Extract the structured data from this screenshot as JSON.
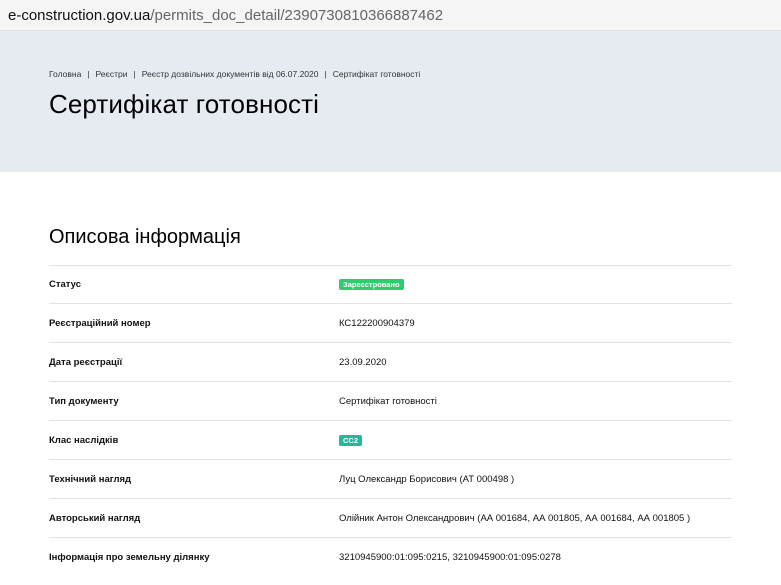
{
  "url": {
    "domain": "e-construction.gov.ua",
    "path": "/permits_doc_detail/2390730810366887462"
  },
  "breadcrumb": [
    "Головна",
    "Реєстри",
    "Реєстр дозвільних документів від 06.07.2020",
    "Сертифікат готовності"
  ],
  "page_title": "Сертифікат готовності",
  "section_title": "Описова інформація",
  "rows": [
    {
      "label": "Статус",
      "value": "Зареєстровано",
      "badge": "green"
    },
    {
      "label": "Реєстраційний номер",
      "value": "КС122200904379"
    },
    {
      "label": "Дата реєстрації",
      "value": "23.09.2020"
    },
    {
      "label": "Тип документу",
      "value": "Сертифікат готовності"
    },
    {
      "label": "Клас наслідків",
      "value": "СС2",
      "badge": "teal"
    },
    {
      "label": "Технічний нагляд",
      "value": "Луц Олександр Борисович (АТ 000498 )"
    },
    {
      "label": "Авторський нагляд",
      "value": "Олійник Антон Олександрович (АА 001684, АА 001805, АА 001684, АА 001805 )"
    },
    {
      "label": "Інформація про земельну ділянку",
      "value": "3210945900:01:095:0215, 3210945900:01:095:0278"
    }
  ],
  "colors": {
    "hero_bg": "#e6ebf2",
    "badge_green": "#2ecc71",
    "badge_teal": "#1abc9c"
  }
}
